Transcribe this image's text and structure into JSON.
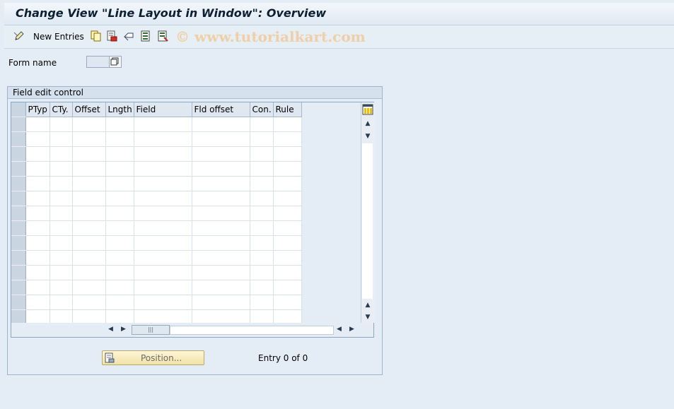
{
  "window": {
    "title": "Change View \"Line Layout in Window\": Overview"
  },
  "toolbar": {
    "new_entries_label": "New Entries",
    "watermark": "© www.tutorialkart.com"
  },
  "form": {
    "label": "Form name",
    "value": ""
  },
  "group": {
    "title": "Field edit control",
    "columns": [
      "PTyp",
      "CTy.",
      "Offset",
      "Lngth",
      "Field",
      "Fld offset",
      "Con.",
      "Rule"
    ],
    "row_count": 14
  },
  "footer": {
    "position_button_label": "Position...",
    "entry_text": "Entry 0 of 0"
  },
  "colors": {
    "background": "#e4edf6",
    "title": "#0c1f33",
    "watermark": "#efcfa7",
    "position_button": "#f1e3a6"
  }
}
